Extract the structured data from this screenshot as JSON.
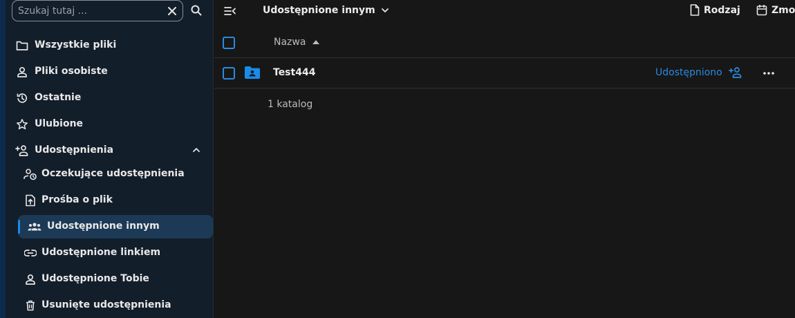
{
  "search": {
    "placeholder": "Szukaj tutaj ..."
  },
  "sidebar": {
    "items": [
      {
        "label": "Wszystkie pliki",
        "icon": "folder-icon"
      },
      {
        "label": "Pliki osobiste",
        "icon": "person-icon"
      },
      {
        "label": "Ostatnie",
        "icon": "history-icon"
      },
      {
        "label": "Ulubione",
        "icon": "star-icon"
      },
      {
        "label": "Udostępnienia",
        "icon": "share-person-icon",
        "expanded": true
      }
    ],
    "sub_items": [
      {
        "label": "Oczekujące udostępnienia",
        "icon": "pending-share-icon"
      },
      {
        "label": "Prośba o plik",
        "icon": "file-upload-icon"
      },
      {
        "label": "Udostępnione innym",
        "icon": "group-icon",
        "active": true
      },
      {
        "label": "Udostępnione linkiem",
        "icon": "link-icon"
      },
      {
        "label": "Udostępnione Tobie",
        "icon": "person-icon"
      },
      {
        "label": "Usunięte udostępnienia",
        "icon": "trash-icon"
      }
    ]
  },
  "header": {
    "breadcrumb": "Udostępnione innym",
    "filters": [
      {
        "label": "Rodzaj",
        "icon": "file-icon"
      },
      {
        "label": "Zmo",
        "icon": "calendar-icon"
      }
    ]
  },
  "table": {
    "column_name": "Nazwa",
    "rows": [
      {
        "name": "Test444",
        "share_status": "Udostępniono",
        "icon": "shared-folder-icon"
      }
    ],
    "summary": "1 katalog"
  },
  "colors": {
    "accent": "#2b8ae0",
    "active_bg": "#1c3a56",
    "sidebar_bg": "#131e2b",
    "main_bg": "#171717"
  }
}
